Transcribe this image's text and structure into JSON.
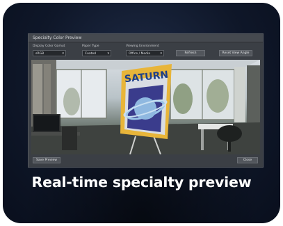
{
  "window": {
    "title": "Specialty Color Preview",
    "controls": {
      "display_gamut_label": "Display Color Gamut",
      "display_gamut_value": "sRGB",
      "paper_type_label": "Paper Type",
      "paper_type_value": "Coated",
      "viewing_env_label": "Viewing Environment",
      "viewing_env_value": "Office / Media"
    },
    "buttons": {
      "refresh": "Refresh",
      "reset_view": "Reset View Angle",
      "save_preview": "Save Preview",
      "close": "Close"
    }
  },
  "poster": {
    "title": "SATURN"
  },
  "caption": "Real-time specialty preview",
  "colors": {
    "background": "#0f1729",
    "window": "#3b3f45",
    "poster_accent": "#e8b53a"
  }
}
